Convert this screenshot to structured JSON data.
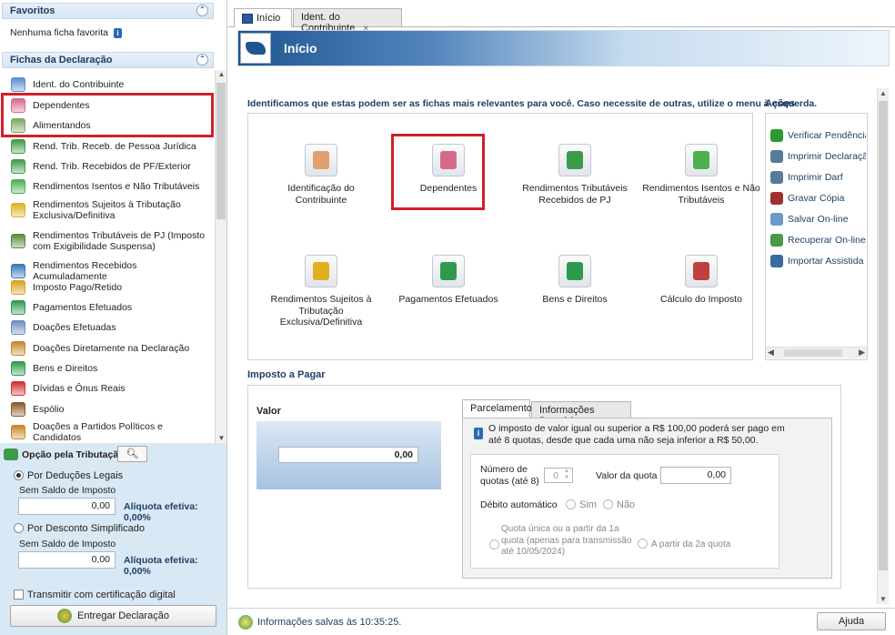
{
  "left": {
    "favoritos_title": "Favoritos",
    "favoritos_empty": "Nenhuma ficha favorita",
    "fichas_title": "Fichas da Declaração",
    "items": [
      {
        "label": "Ident. do Contribuinte",
        "icon": "person-icon",
        "color": "#5a8fd0"
      },
      {
        "label": "Dependentes",
        "icon": "dependents-icon",
        "color": "#d66a8a"
      },
      {
        "label": "Alimentandos",
        "icon": "alimentandos-icon",
        "color": "#7aa860"
      },
      {
        "label": "Rend. Trib. Receb. de Pessoa Jurídica",
        "icon": "income-pj-icon",
        "color": "#3d9a4a"
      },
      {
        "label": "Rend. Trib. Recebidos de PF/Exterior",
        "icon": "income-pf-icon",
        "color": "#3d9a4a"
      },
      {
        "label": "Rendimentos Isentos e Não Tributáveis",
        "icon": "exempt-icon",
        "color": "#4caf50"
      },
      {
        "label": "Rendimentos Sujeitos à Tributação Exclusiva/Definitiva",
        "icon": "warning-doc-icon",
        "color": "#e0b020"
      },
      {
        "label": "Rendimentos Tributáveis de PJ (Imposto com Exigibilidade Suspensa)",
        "icon": "suspended-icon",
        "color": "#5a8a3a"
      },
      {
        "label": "Rendimentos Recebidos Acumuladamente",
        "icon": "accumulated-icon",
        "color": "#3a78b8"
      },
      {
        "label": "Imposto Pago/Retido",
        "icon": "tax-paid-icon",
        "color": "#d9a020"
      },
      {
        "label": "Pagamentos Efetuados",
        "icon": "payments-icon",
        "color": "#2e9a4e"
      },
      {
        "label": "Doações Efetuadas",
        "icon": "donations-icon",
        "color": "#6c8fc0"
      },
      {
        "label": "Doações Diretamente na Declaração",
        "icon": "direct-donation-icon",
        "color": "#c8882a"
      },
      {
        "label": "Bens e Direitos",
        "icon": "assets-icon",
        "color": "#2e9a4e"
      },
      {
        "label": "Dívidas e Ônus Reais",
        "icon": "debts-icon",
        "color": "#d03030"
      },
      {
        "label": "Espólio",
        "icon": "estate-icon",
        "color": "#8a5a2a"
      },
      {
        "label": "Doações a Partidos Políticos e Candidatos",
        "icon": "political-donation-icon",
        "color": "#c8882a"
      }
    ],
    "opcao": {
      "title": "Opção pela Tributação:",
      "deducoes_label": "Por Deduções Legais",
      "deducoes_saldo": "Sem Saldo de Imposto",
      "deducoes_valor": "0,00",
      "deducoes_aliquota": "Alíquota efetiva: 0,00%",
      "simplificado_label": "Por Desconto Simplificado",
      "simplificado_saldo": "Sem Saldo de Imposto",
      "simplificado_valor": "0,00",
      "simplificado_aliquota": "Alíquota efetiva: 0,00%",
      "certificado_label": "Transmitir com certificação digital",
      "entregar_label": "Entregar Declaração"
    }
  },
  "tabs": [
    {
      "label": "Início",
      "active": true
    },
    {
      "label": "Ident. do Contribuinte",
      "active": false,
      "close": "×"
    }
  ],
  "banner_title": "Início",
  "intro": "Identificamos que estas podem ser as fichas mais relevantes para você. Caso necessite de outras, utilize o menu à esquerda.",
  "cards": [
    {
      "label": "Identificação do Contribuinte",
      "icon": "person-card-icon",
      "color": "#e0a070"
    },
    {
      "label": "Dependentes",
      "icon": "dependents-card-icon",
      "color": "#d66a8a"
    },
    {
      "label": "Rendimentos Tributáveis Recebidos de PJ",
      "icon": "income-card-icon",
      "color": "#3d9a4a"
    },
    {
      "label": "Rendimentos Isentos e Não Tributáveis",
      "icon": "exempt-card-icon",
      "color": "#4caf50"
    },
    {
      "label": "Rendimentos Sujeitos à Tributação Exclusiva/Definitiva",
      "icon": "warning-card-icon",
      "color": "#e0b020"
    },
    {
      "label": "Pagamentos Efetuados",
      "icon": "payments-card-icon",
      "color": "#2e9a4e"
    },
    {
      "label": "Bens e Direitos",
      "icon": "assets-card-icon",
      "color": "#2e9a4e"
    },
    {
      "label": "Cálculo do Imposto",
      "icon": "calculation-card-icon",
      "color": "#c04040"
    }
  ],
  "acoes": {
    "title": "Ações",
    "items": [
      {
        "label": "Verificar Pendências",
        "icon": "check-icon",
        "color": "#2e9a2e"
      },
      {
        "label": "Imprimir Declaração",
        "icon": "printer-icon",
        "color": "#5a7a9a"
      },
      {
        "label": "Imprimir Darf",
        "icon": "printer-darf-icon",
        "color": "#5a7a9a"
      },
      {
        "label": "Gravar Cópia",
        "icon": "save-icon",
        "color": "#a03030"
      },
      {
        "label": "Salvar On-line",
        "icon": "cloud-save-icon",
        "color": "#6a9ac8"
      },
      {
        "label": "Recuperar On-line",
        "icon": "cloud-restore-icon",
        "color": "#4a9a4a"
      },
      {
        "label": "Importar Assistida",
        "icon": "import-icon",
        "color": "#3a6aa0"
      }
    ]
  },
  "imposto": {
    "title": "Imposto a Pagar",
    "valor_label": "Valor",
    "valor": "0,00",
    "tab_parcelamento": "Parcelamento",
    "tab_bancarias": "Informações Bancárias",
    "info": "O imposto de valor igual ou superior a R$ 100,00 poderá ser pago em até 8 quotas, desde que cada uma não seja inferior a R$ 50,00.",
    "num_quotas_label": "Número de quotas (até 8)",
    "num_quotas": "0",
    "valor_quota_label": "Valor da quota",
    "valor_quota": "0,00",
    "debito_label": "Débito automático",
    "sim": "Sim",
    "nao": "Não",
    "quota_unica": "Quota única ou a partir da 1a quota (apenas para transmissão até 10/05/2024)",
    "segunda_quota": "A partir da 2a quota"
  },
  "status": "Informações salvas às 10:35:25.",
  "ajuda_label": "Ajuda"
}
